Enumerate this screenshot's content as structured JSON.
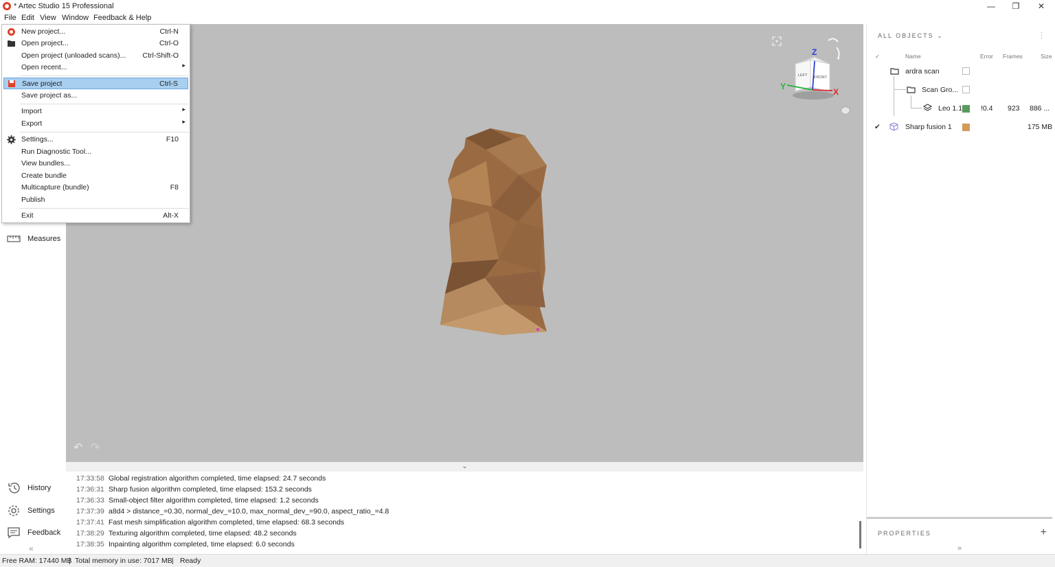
{
  "window": {
    "title": "* Artec Studio 15 Professional",
    "minimize": "—",
    "maximize": "❐",
    "close": "✕"
  },
  "menubar": [
    "File",
    "Edit",
    "View",
    "Window",
    "Feedback & Help"
  ],
  "file_menu": [
    {
      "label": "New project...",
      "shortcut": "Ctrl-N",
      "icon": "new-project-icon"
    },
    {
      "label": "Open project...",
      "shortcut": "Ctrl-O",
      "icon": "folder-icon"
    },
    {
      "label": "Open project (unloaded scans)...",
      "shortcut": "Ctrl-Shift-O"
    },
    {
      "label": "Open recent...",
      "shortcut": "",
      "submenu": true
    },
    {
      "label": "Save project",
      "shortcut": "Ctrl-S",
      "icon": "save-icon",
      "selected": true
    },
    {
      "label": "Save project as...",
      "shortcut": ""
    },
    {
      "label": "Import",
      "shortcut": "",
      "submenu": true
    },
    {
      "label": "Export",
      "shortcut": "",
      "submenu": true
    },
    {
      "label": "Settings...",
      "shortcut": "F10",
      "icon": "gear-icon"
    },
    {
      "label": "Run Diagnostic Tool...",
      "shortcut": ""
    },
    {
      "label": "View bundles...",
      "shortcut": ""
    },
    {
      "label": "Create bundle",
      "shortcut": ""
    },
    {
      "label": "Multicapture (bundle)",
      "shortcut": "F8"
    },
    {
      "label": "Publish",
      "shortcut": ""
    },
    {
      "label": "Exit",
      "shortcut": "Alt-X"
    }
  ],
  "left_nav": {
    "measures": "Measures",
    "history": "History",
    "settings": "Settings",
    "feedback": "Feedback",
    "collapse": "«"
  },
  "viewport": {
    "gizmo": {
      "z": "Z",
      "y": "Y",
      "x": "X",
      "left": "LEFT",
      "front": "FRONT"
    },
    "model_color": "#9a6b42",
    "background": "#bdbdbd",
    "collapse": "⌄"
  },
  "log": [
    {
      "time": "17:33:58",
      "text": "Global registration algorithm completed, time elapsed: 24.7 seconds"
    },
    {
      "time": "17:36:31",
      "text": "Sharp fusion algorithm completed, time elapsed: 153.2 seconds"
    },
    {
      "time": "17:36:33",
      "text": "Small-object filter algorithm completed, time elapsed: 1.2 seconds"
    },
    {
      "time": "17:37:39",
      "text": "a8d4 > distance_=0.30, normal_dev_=10.0, max_normal_dev_=90.0, aspect_ratio_=4.8"
    },
    {
      "time": "17:37:41",
      "text": "Fast mesh simplification algorithm completed, time elapsed: 68.3 seconds"
    },
    {
      "time": "17:38:29",
      "text": "Texturing algorithm completed, time elapsed: 48.2 seconds"
    },
    {
      "time": "17:38:35",
      "text": "Inpainting algorithm completed, time elapsed: 6.0 seconds"
    }
  ],
  "statusbar": {
    "free_ram": "Free RAM: 17440 MB",
    "sep1": "|",
    "total_mem": "Total memory in use: 7017 MB",
    "sep2": "|",
    "status": "Ready"
  },
  "objects_panel": {
    "header": "ALL OBJECTS",
    "chevron": "⌄",
    "more": "⋮",
    "columns": {
      "check": "✓",
      "name": "Name",
      "error": "Error",
      "frames": "Frames",
      "size": "Size"
    },
    "rows": [
      {
        "name": "ardra scan",
        "type": "folder-icon"
      },
      {
        "name": "Scan Gro...",
        "type": "folder-icon"
      },
      {
        "name": "Leo 1.1",
        "type": "layers-icon",
        "color": "#5a9a5f",
        "error": "!0.4",
        "frames": "923",
        "size": "886 ..."
      },
      {
        "name": "Sharp fusion 1",
        "type": "cube-icon",
        "color": "#d39a5c",
        "size": "175 MB",
        "checked": "✔"
      }
    ]
  },
  "properties_panel": {
    "header": "PROPERTIES",
    "add": "+",
    "collapse": "»"
  }
}
